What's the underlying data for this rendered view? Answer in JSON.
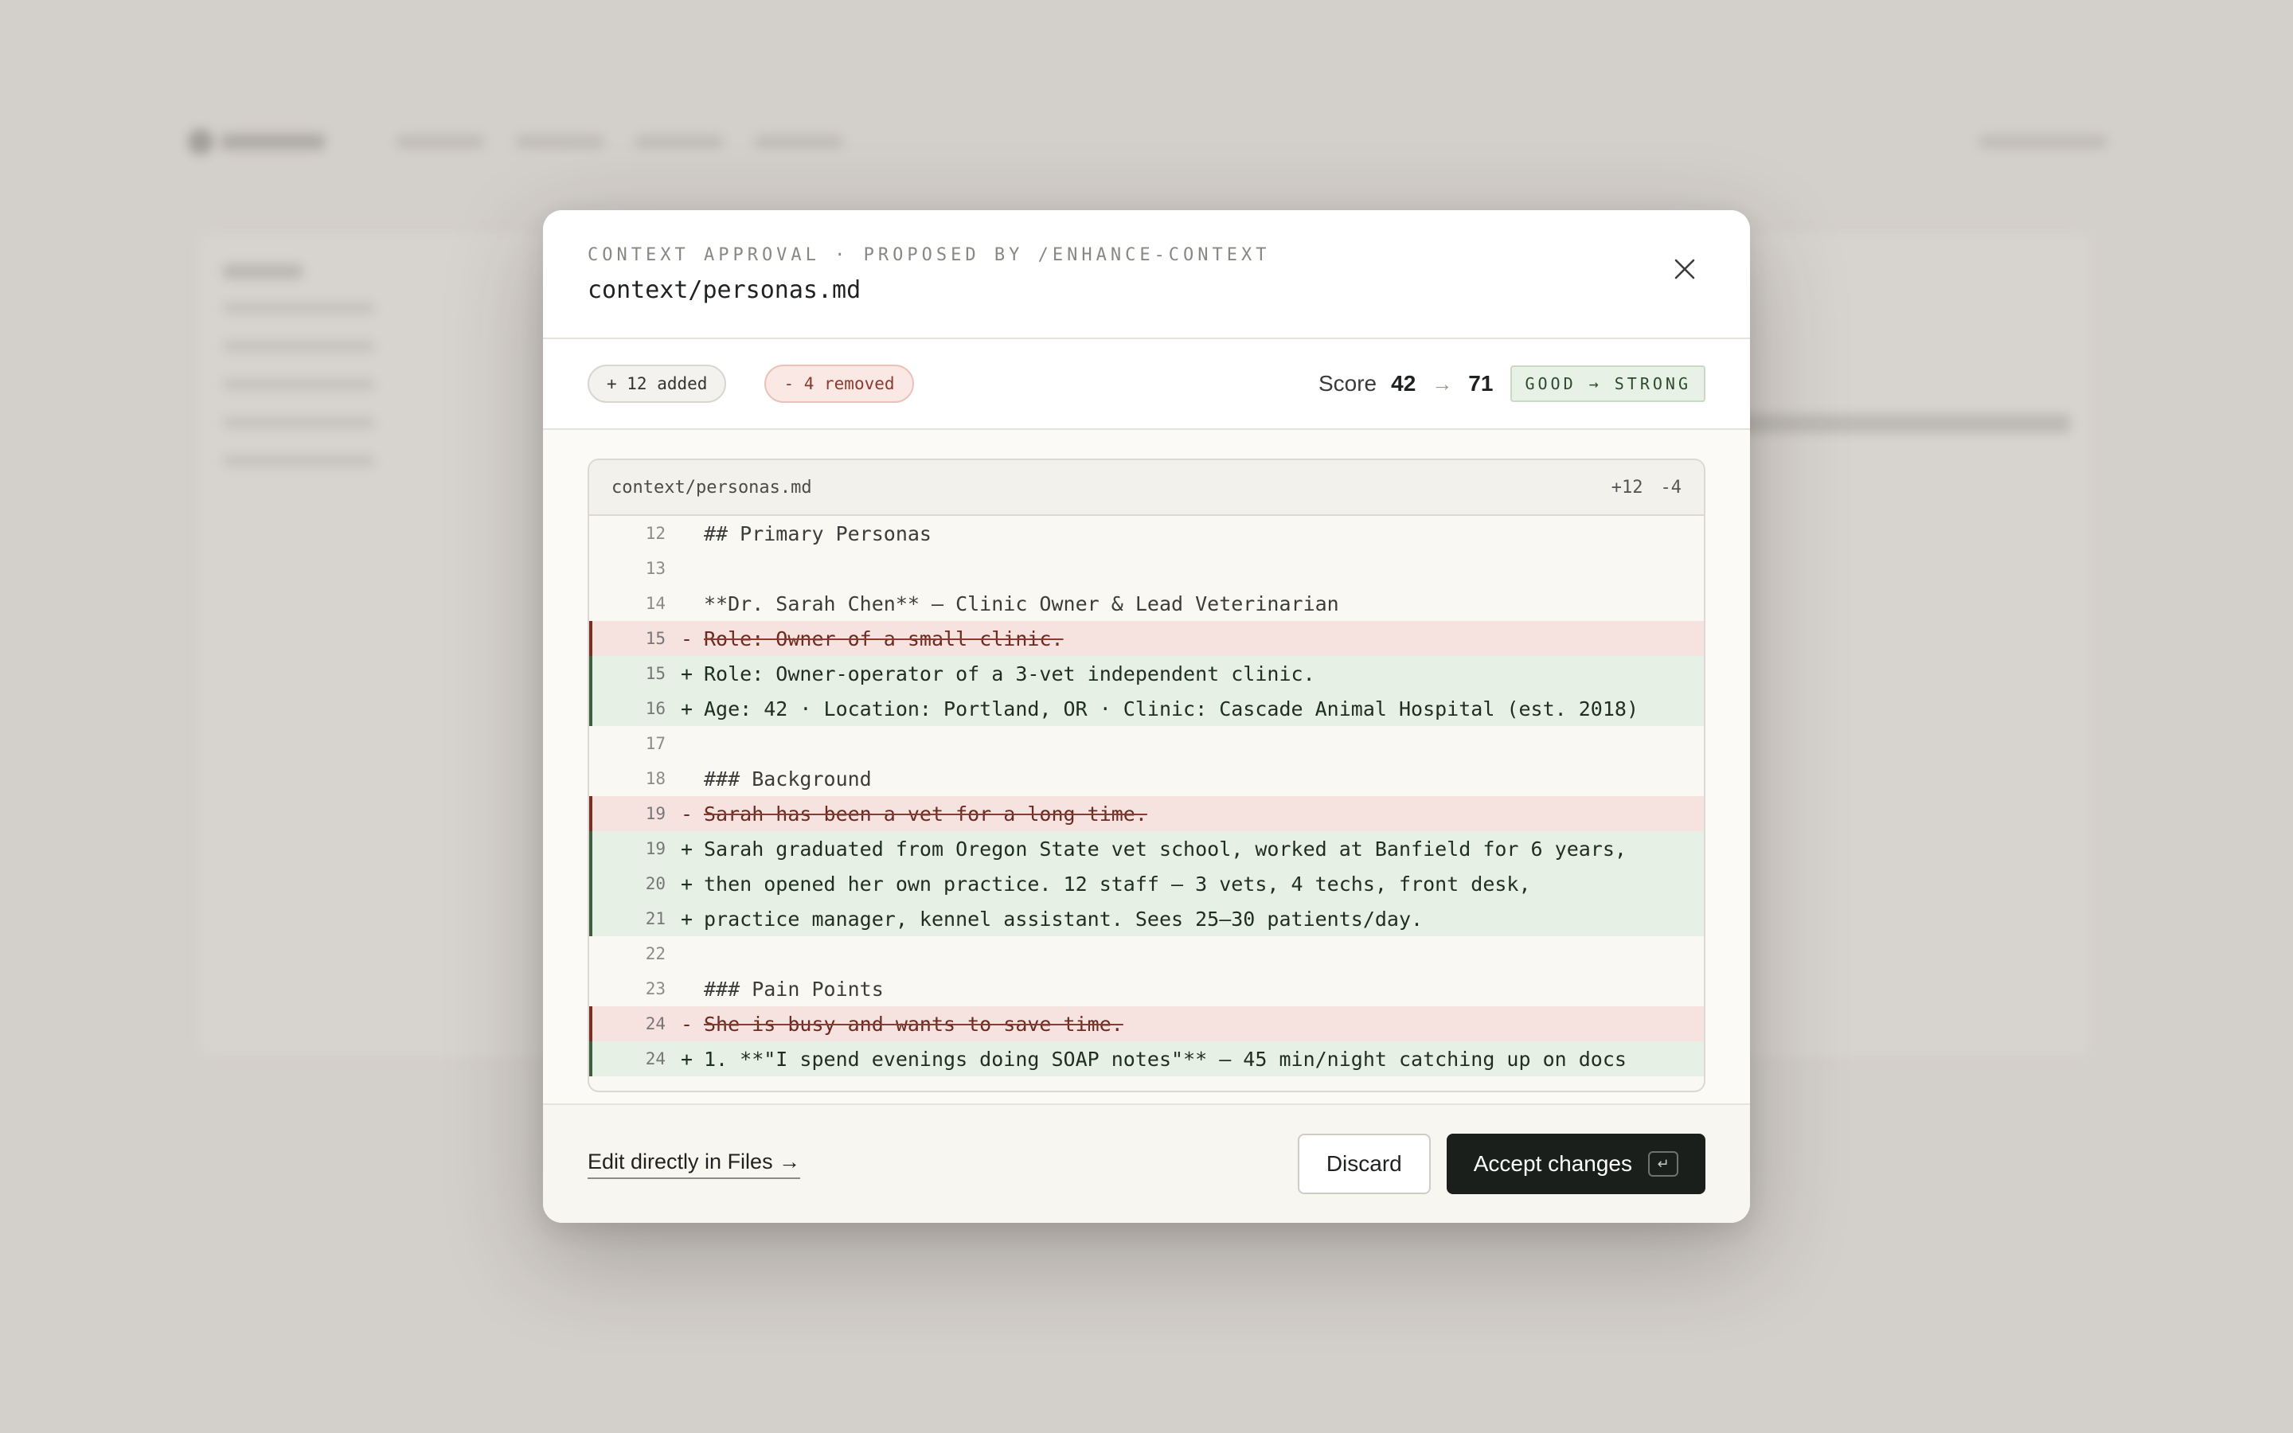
{
  "modal": {
    "eyebrow": "CONTEXT APPROVAL · PROPOSED BY /ENHANCE-CONTEXT",
    "title": "context/personas.md",
    "close_icon": "close-icon"
  },
  "stats": {
    "added": "+ 12 added",
    "removed": "- 4 removed",
    "score_label": "Score",
    "score_from": "42",
    "score_arrow": "→",
    "score_to": "71",
    "grade": "GOOD → STRONG"
  },
  "diff": {
    "file": "context/personas.md",
    "plus_count": "+12",
    "minus_count": "-4",
    "lines": [
      {
        "type": "ctx",
        "num": "12",
        "sign": " ",
        "text": "## Primary Personas"
      },
      {
        "type": "ctx",
        "num": "13",
        "sign": " ",
        "text": ""
      },
      {
        "type": "ctx",
        "num": "14",
        "sign": " ",
        "text": "**Dr. Sarah Chen** — Clinic Owner & Lead Veterinarian"
      },
      {
        "type": "del",
        "num": "15",
        "sign": "-",
        "text": "Role: Owner of a small clinic."
      },
      {
        "type": "add",
        "num": "15",
        "sign": "+",
        "text": "Role: Owner-operator of a 3-vet independent clinic."
      },
      {
        "type": "add",
        "num": "16",
        "sign": "+",
        "text": "Age: 42 · Location: Portland, OR · Clinic: Cascade Animal Hospital (est. 2018)"
      },
      {
        "type": "ctx",
        "num": "17",
        "sign": " ",
        "text": ""
      },
      {
        "type": "ctx",
        "num": "18",
        "sign": " ",
        "text": "### Background"
      },
      {
        "type": "del",
        "num": "19",
        "sign": "-",
        "text": "Sarah has been a vet for a long time."
      },
      {
        "type": "add",
        "num": "19",
        "sign": "+",
        "text": "Sarah graduated from Oregon State vet school, worked at Banfield for 6 years,"
      },
      {
        "type": "add",
        "num": "20",
        "sign": "+",
        "text": "then opened her own practice. 12 staff — 3 vets, 4 techs, front desk,"
      },
      {
        "type": "add",
        "num": "21",
        "sign": "+",
        "text": "practice manager, kennel assistant. Sees 25–30 patients/day."
      },
      {
        "type": "ctx",
        "num": "22",
        "sign": " ",
        "text": ""
      },
      {
        "type": "ctx",
        "num": "23",
        "sign": " ",
        "text": "### Pain Points"
      },
      {
        "type": "del",
        "num": "24",
        "sign": "-",
        "text": "She is busy and wants to save time."
      },
      {
        "type": "add",
        "num": "24",
        "sign": "+",
        "text": "1. **\"I spend evenings doing SOAP notes\"** — 45 min/night catching up on docs"
      }
    ]
  },
  "footer": {
    "edit_link": "Edit directly in Files →",
    "discard": "Discard",
    "accept": "Accept changes",
    "accept_kbd": "↵"
  }
}
